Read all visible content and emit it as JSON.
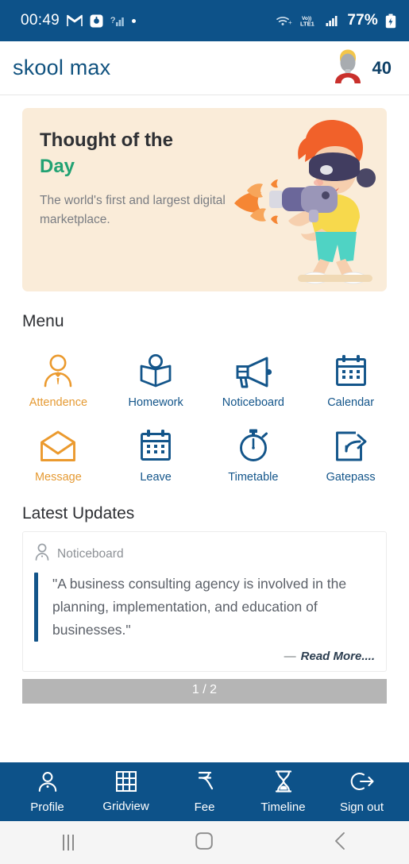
{
  "status_bar": {
    "time": "00:49",
    "battery": "77%",
    "network_label": "VoLTE1",
    "icons": [
      "gmail-icon",
      "app-notification-icon",
      "signal-question-icon",
      "dot-icon",
      "wifi-icon",
      "volte-icon",
      "cellular-signal-icon",
      "battery-icon"
    ],
    "colors": {
      "background": "#0d5289",
      "foreground": "#ffffff"
    }
  },
  "app_bar": {
    "brand": "skool max",
    "badge_count": "40",
    "avatar_name": "user-avatar",
    "colors": {
      "brand": "#10527f",
      "badge": "#0d3f66"
    }
  },
  "thought_card": {
    "title_line1": "Thought of the",
    "title_line2": "Day",
    "body": "The world's first and largest digital marketplace.",
    "illustration": "boy-with-vr-headset-and-toy-blaster",
    "colors": {
      "background": "#faecd9",
      "title": "#2e3034",
      "accent": "#22a273",
      "body": "#7a7d83"
    }
  },
  "menu": {
    "title": "Menu",
    "items": [
      {
        "label": "Attendence",
        "icon": "person-with-tie-icon",
        "color": "#e59a33"
      },
      {
        "label": "Homework",
        "icon": "open-book-icon",
        "color": "#13558a"
      },
      {
        "label": "Noticeboard",
        "icon": "megaphone-icon",
        "color": "#13558a"
      },
      {
        "label": "Calendar",
        "icon": "calendar-icon",
        "color": "#13558a"
      },
      {
        "label": "Message",
        "icon": "open-envelope-icon",
        "color": "#e59a33"
      },
      {
        "label": "Leave",
        "icon": "calendar-icon",
        "color": "#13558a"
      },
      {
        "label": "Timetable",
        "icon": "stopwatch-icon",
        "color": "#13558a"
      },
      {
        "label": "Gatepass",
        "icon": "exit-arrow-box-icon",
        "color": "#13558a"
      }
    ]
  },
  "latest_updates": {
    "title": "Latest Updates",
    "source_icon": "person-outline-icon",
    "source": "Noticeboard",
    "quote": "\"A business consulting agency is involved in the planning, implementation, and education of businesses.\"",
    "read_more_dash": "—",
    "read_more": "Read More....",
    "pager": "1 / 2",
    "colors": {
      "quote_bar": "#13558a",
      "quote_text": "#5b6068",
      "pager_bg": "#b5b5b5"
    }
  },
  "bottom_nav": {
    "items": [
      {
        "label": "Profile",
        "icon": "person-icon"
      },
      {
        "label": "Gridview",
        "icon": "grid-icon"
      },
      {
        "label": "Fee",
        "icon": "rupee-icon"
      },
      {
        "label": "Timeline",
        "icon": "hourglass-icon"
      },
      {
        "label": "Sign out",
        "icon": "sign-out-icon"
      }
    ],
    "colors": {
      "background": "#0d5289",
      "foreground": "#ffffff"
    }
  },
  "android_nav": {
    "items": [
      {
        "label": "Recents",
        "icon": "recents-icon"
      },
      {
        "label": "Home",
        "icon": "home-square-icon"
      },
      {
        "label": "Back",
        "icon": "back-chevron-icon"
      }
    ]
  }
}
